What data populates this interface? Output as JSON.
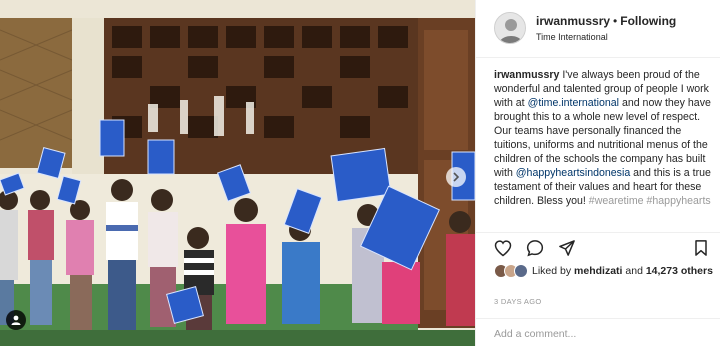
{
  "post": {
    "username": "irwanmussry",
    "separator": "•",
    "follow_label": "Following",
    "location": "Time International",
    "caption_user": "irwanmussry",
    "caption_parts": [
      {
        "type": "text",
        "value": " I've always been proud of the wonderful and talented group of people I work with at "
      },
      {
        "type": "mention",
        "value": "@time.international"
      },
      {
        "type": "text",
        "value": " and now they have brought this to a whole new level of respect. Our teams have personally financed the tuitions, uniforms and nutritional menus of the children of the schools the company has built with "
      },
      {
        "type": "mention",
        "value": "@happyheartsindonesia"
      },
      {
        "type": "text",
        "value": " and this is a true testament of their values and heart for these children. Bless you!"
      },
      {
        "type": "faded",
        "value": " #wearetime #happyhearts"
      }
    ],
    "likes": {
      "prefix": "Liked by ",
      "liker": "mehdizati",
      "and": " and ",
      "count": "14,273 others"
    },
    "timestamp": "3 DAYS AGO",
    "comment_placeholder": "Add a comment..."
  },
  "icons": {
    "heart": "heart-icon",
    "comment": "comment-icon",
    "share": "share-icon",
    "save": "bookmark-icon",
    "next": "chevron-right-icon",
    "tag": "user-tag-icon"
  },
  "colors": {
    "mention": "#003569",
    "text": "#262626",
    "muted": "#999999",
    "border": "#efefef"
  }
}
